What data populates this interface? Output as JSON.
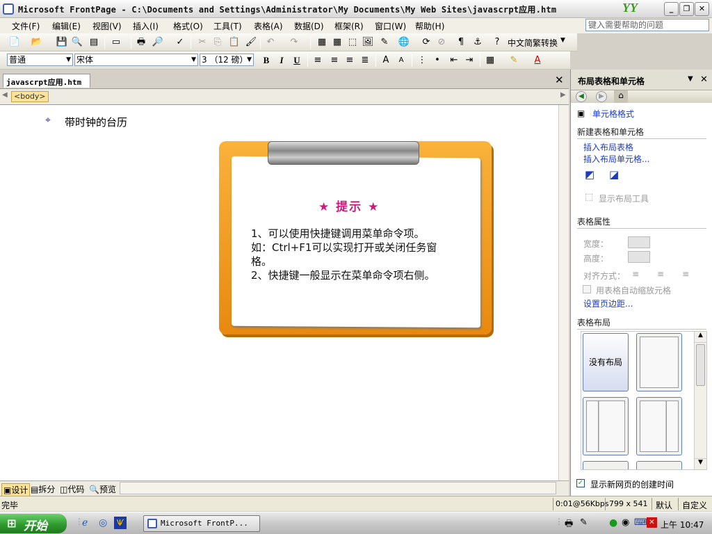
{
  "window": {
    "title": "Microsoft FrontPage - C:\\Documents and Settings\\Administrator\\My Documents\\My Web Sites\\javascrpt应用.htm",
    "logo_text": "YY"
  },
  "menu": {
    "items": [
      "文件(F)",
      "编辑(E)",
      "视图(V)",
      "插入(I)",
      "格式(O)",
      "工具(T)",
      "表格(A)",
      "数据(D)",
      "框架(R)",
      "窗口(W)",
      "帮助(H)"
    ],
    "help_placeholder": "键入需要帮助的问题"
  },
  "toolbar": {
    "convert_label": "中文简繁转换",
    "style_value": "普通",
    "font_value": "宋体",
    "size_value": "3 （12 磅）"
  },
  "document": {
    "tab_label": "javascrpt应用.htm",
    "body_tag": "<body>",
    "heading": "带时钟的台历",
    "tip_title": "★ 提示 ★",
    "tip_lines": [
      "1、可以使用快捷键调用菜单命令项。",
      "如：Ctrl+F1可以实现打开或关闭任务窗格。",
      "2、快捷键一般显示在菜单命令项右侧。"
    ]
  },
  "view_tabs": [
    "设计",
    "拆分",
    "代码",
    "预览"
  ],
  "status": {
    "left": "完毕",
    "speed": "0:01@56Kbps",
    "resolution": "799 x 541",
    "mode1": "默认",
    "mode2": "自定义"
  },
  "taskpane": {
    "title": "布局表格和单元格",
    "cell_format": "单元格格式",
    "new_section": "新建表格和单元格",
    "insert_table": "插入布局表格",
    "insert_cell": "插入布局单元格...",
    "show_tools": "显示布局工具",
    "props_section": "表格属性",
    "width_label": "宽度：",
    "height_label": "高度：",
    "align_label": "对齐方式：",
    "autoscale": "用表格自动缩放元格",
    "margins_link": "设置页边距...",
    "layout_section": "表格布局",
    "no_layout": "没有布局",
    "show_created": "显示新网页的创建时间"
  },
  "taskbar": {
    "start": "开始",
    "app_button": "Microsoft FrontP...",
    "clock": "上午 10:47"
  }
}
